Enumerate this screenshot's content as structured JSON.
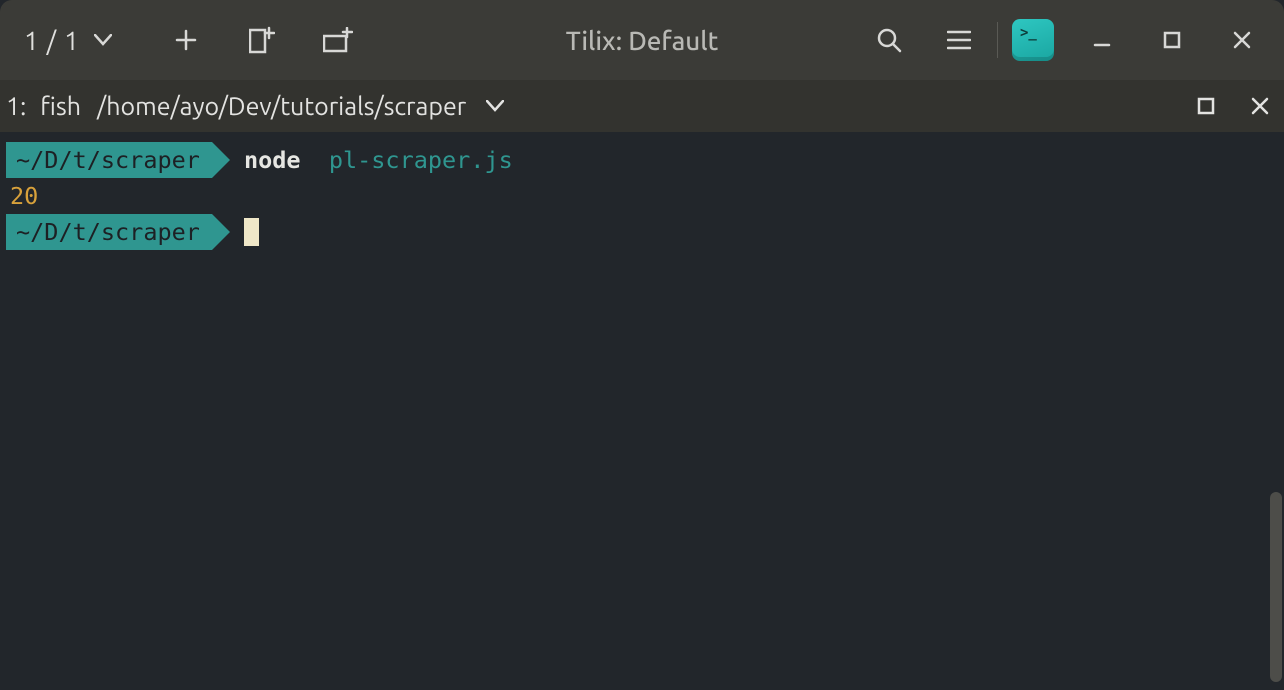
{
  "titlebar": {
    "session_counter": "1 / 1",
    "app_title": "Tilix: Default"
  },
  "tab": {
    "index": "1",
    "shell": "fish",
    "path": "/home/ayo/Dev/tutorials/scraper"
  },
  "terminal": {
    "prompt_path": "~/D/t/scraper",
    "cmd_bin": "node",
    "cmd_arg": "pl-scraper.js",
    "output": "20"
  },
  "colors": {
    "accent": "#2f9690",
    "output_num": "#d8a13b",
    "bg": "#22262b"
  }
}
